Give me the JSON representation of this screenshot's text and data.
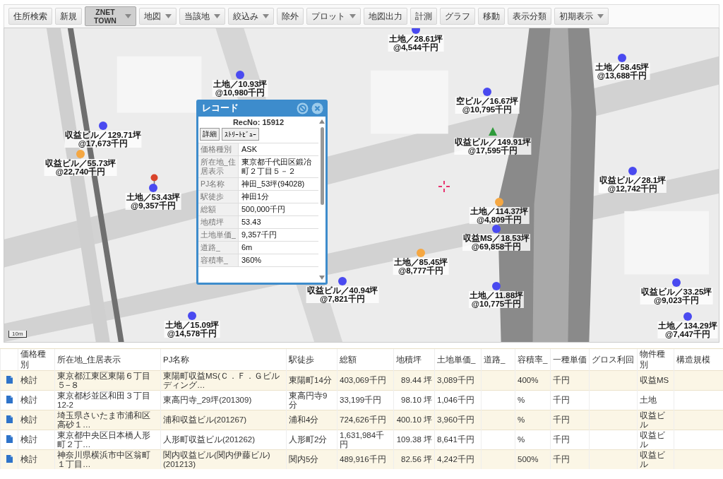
{
  "toolbar": [
    {
      "label": "住所検索",
      "has_menu": false,
      "selected": false
    },
    {
      "label": "新規",
      "has_menu": false,
      "selected": false
    },
    {
      "label": "ZNET TOWN",
      "has_menu": true,
      "selected": true
    },
    {
      "label": "地図",
      "has_menu": true,
      "selected": false
    },
    {
      "label": "当該地",
      "has_menu": true,
      "selected": false
    },
    {
      "label": "絞込み",
      "has_menu": true,
      "selected": false
    },
    {
      "label": "除外",
      "has_menu": false,
      "selected": false
    },
    {
      "label": "プロット",
      "has_menu": true,
      "selected": false
    },
    {
      "label": "地図出力",
      "has_menu": false,
      "selected": false
    },
    {
      "label": "計測",
      "has_menu": false,
      "selected": false
    },
    {
      "label": "グラフ",
      "has_menu": false,
      "selected": false
    },
    {
      "label": "移動",
      "has_menu": false,
      "selected": false
    },
    {
      "label": "表示分類",
      "has_menu": false,
      "selected": false
    },
    {
      "label": "初期表示",
      "has_menu": true,
      "selected": false
    }
  ],
  "map": {
    "kind": "picture",
    "scale": "10m",
    "markers": [
      {
        "kind": "dot",
        "color": "#4a4af0",
        "title": "土地／10.93坪",
        "price": "@10,980千円"
      },
      {
        "kind": "dot",
        "color": "#4a4af0",
        "title": "収益ビル／129.71坪",
        "price": "@17,673千円"
      },
      {
        "kind": "dot",
        "color": "#f5a742",
        "title": "収益ビル／55.73坪",
        "price": "@22,740千円"
      },
      {
        "kind": "pin",
        "color": "#d9442b"
      },
      {
        "kind": "dot",
        "color": "#4a4af0",
        "title": "土地／53.43坪",
        "price": "@9,357千円"
      },
      {
        "kind": "dot",
        "color": "#4a4af0",
        "title": "土地／15.09坪",
        "price": "@14,578千円"
      },
      {
        "kind": "dot",
        "color": "#4a4af0",
        "title": "収益ビル／40.94坪",
        "price": "@7,821千円"
      },
      {
        "kind": "dot",
        "color": "#4a4af0",
        "title": "土地／28.61坪",
        "price": "@4,544千円"
      },
      {
        "kind": "dot",
        "color": "#4a4af0",
        "title": "空ビル／16.67坪",
        "price": "@10,795千円"
      },
      {
        "kind": "triangle",
        "color": "#2e9a3a",
        "title": "収益ビル／149.91坪",
        "price": "@17,595千円"
      },
      {
        "kind": "dot",
        "color": "#4a4af0",
        "title": "土地／58.45坪",
        "price": "@13,688千円"
      },
      {
        "kind": "dot",
        "color": "#4a4af0",
        "title": "収益ビル／28.1坪",
        "price": "@12,742千円"
      },
      {
        "kind": "dot",
        "color": "#f5a742",
        "title": "土地／114.37坪",
        "price": "@4,809千円"
      },
      {
        "kind": "dot",
        "color": "#4a4af0",
        "title": "収益MS／18.53坪",
        "price": "@69,858千円"
      },
      {
        "kind": "dot",
        "color": "#f5a742",
        "title": "土地／85.45坪",
        "price": "@8,777千円"
      },
      {
        "kind": "dot",
        "color": "#4a4af0",
        "title": "土地／11.88坪",
        "price": "@10,775千円"
      },
      {
        "kind": "dot",
        "color": "#4a4af0",
        "title": "収益ビル／33.25坪",
        "price": "@9,023千円"
      },
      {
        "kind": "dot",
        "color": "#4a4af0",
        "title": "土地／134.29坪",
        "price": "@7,447千円"
      }
    ]
  },
  "popup": {
    "title": "レコード",
    "rec_no": "RecNo: 15912",
    "buttons": [
      "詳細",
      "ｽﾄﾘｰﾄﾋﾞｭｰ"
    ],
    "fields": [
      {
        "label": "価格種別",
        "value": "ASK"
      },
      {
        "label": "所在地_住居表示",
        "value": "東京都千代田区鍛冶町２丁目５－２"
      },
      {
        "label": "PJ名称",
        "value": "神田_53坪(94028)"
      },
      {
        "label": "駅徒歩",
        "value": "神田1分"
      },
      {
        "label": "総額",
        "value": "500,000千円"
      },
      {
        "label": "地積坪",
        "value": "53.43"
      },
      {
        "label": "土地単価_",
        "value": "9,357千円"
      },
      {
        "label": "道路_",
        "value": "6m"
      },
      {
        "label": "容積率_",
        "value": "360%"
      }
    ]
  },
  "table": {
    "columns": [
      "価格種別",
      "所在地_住居表示",
      "PJ名称",
      "駅徒歩",
      "総額",
      "地積坪",
      "土地単価_",
      "道路_",
      "容積率_",
      "一種単価",
      "グロス利回",
      "物件種別",
      "構造規模"
    ],
    "rows": [
      [
        "検討",
        "東京都江東区東陽６丁目５−８",
        "東陽町収益MS(Ｃ．Ｆ．Ｇビルディング…",
        "東陽町14分",
        "403,069千円",
        "89.44 坪",
        "3,089千円",
        "",
        "400%",
        "千円",
        "",
        "収益MS",
        ""
      ],
      [
        "検討",
        "東京都杉並区和田３丁目12-2",
        "東高円寺_29坪(201309)",
        "東高円寺9分",
        "33,199千円",
        "98.10 坪",
        "1,046千円",
        "",
        "%",
        "千円",
        "",
        "土地",
        ""
      ],
      [
        "検討",
        "埼玉県さいたま市浦和区高砂１…",
        "浦和収益ビル(201267)",
        "浦和4分",
        "724,626千円",
        "400.10 坪",
        "3,960千円",
        "",
        "%",
        "千円",
        "",
        "収益ビル",
        ""
      ],
      [
        "検討",
        "東京都中央区日本橋人形町２丁…",
        "人形町収益ビル(201262)",
        "人形町2分",
        "1,631,984千円",
        "109.38 坪",
        "8,641千円",
        "",
        "%",
        "千円",
        "",
        "収益ビル",
        ""
      ],
      [
        "検討",
        "神奈川県横浜市中区翁町１丁目…",
        "関内収益ビル(関内伊藤ビル)(201213)",
        "関内5分",
        "489,916千円",
        "82.56 坪",
        "4,242千円",
        "",
        "500%",
        "千円",
        "",
        "収益ビル",
        ""
      ]
    ]
  }
}
